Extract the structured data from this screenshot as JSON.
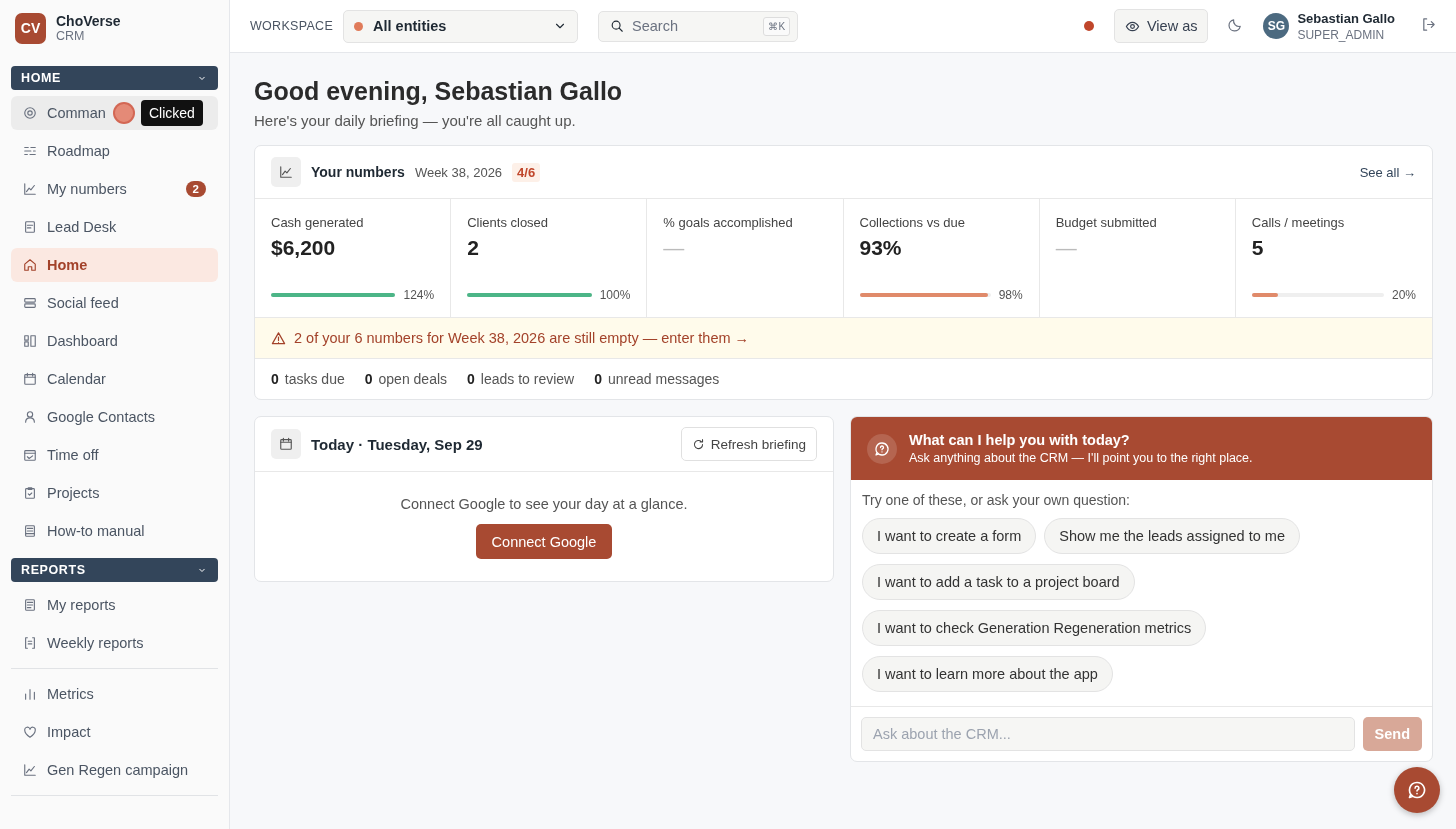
{
  "brand": {
    "initials": "CV",
    "name": "ChoVerse",
    "subtitle": "CRM"
  },
  "sidebar": {
    "groups": [
      {
        "title": "HOME",
        "expanded": true,
        "items": [
          {
            "label": "Comman",
            "selected": false,
            "hovered": true
          },
          {
            "label": "Roadmap",
            "selected": false,
            "hovered": false
          },
          {
            "label": "My numbers",
            "selected": false,
            "hovered": false,
            "badge": "2"
          },
          {
            "label": "Lead Desk",
            "selected": false,
            "hovered": false
          },
          {
            "label": "Home",
            "selected": true,
            "hovered": false
          },
          {
            "label": "Social feed",
            "selected": false,
            "hovered": false
          },
          {
            "label": "Dashboard",
            "selected": false,
            "hovered": false
          },
          {
            "label": "Calendar",
            "selected": false,
            "hovered": false
          },
          {
            "label": "Google Contacts",
            "selected": false,
            "hovered": false
          },
          {
            "label": "Time off",
            "selected": false,
            "hovered": false
          },
          {
            "label": "Projects",
            "selected": false,
            "hovered": false
          },
          {
            "label": "How-to manual",
            "selected": false,
            "hovered": false
          }
        ]
      },
      {
        "title": "REPORTS",
        "expanded": true,
        "items": [
          {
            "label": "My reports",
            "selected": false,
            "hovered": false
          },
          {
            "label": "Weekly reports",
            "selected": false,
            "hovered": false
          }
        ]
      },
      {
        "items": [
          {
            "label": "Metrics",
            "selected": false,
            "hovered": false
          },
          {
            "label": "Impact",
            "selected": false,
            "hovered": false
          },
          {
            "label": "Gen Regen campaign",
            "selected": false,
            "hovered": false
          }
        ]
      }
    ]
  },
  "click_indicator": {
    "tooltip": "Clicked"
  },
  "topbar": {
    "workspace_label": "WORKSPACE",
    "workspace": {
      "value": "All entities",
      "color": "#e07b5a"
    },
    "search": {
      "placeholder": "Search",
      "shortcut": "⌘K"
    },
    "view_as": "View as",
    "user": {
      "initials": "SG",
      "name": "Sebastian Gallo",
      "role": "SUPER_ADMIN"
    }
  },
  "greeting": {
    "title": "Good evening, Sebastian Gallo",
    "subtitle": "Here's your daily briefing — you're all caught up."
  },
  "numbers": {
    "title": "Your numbers",
    "week": "Week 38, 2026",
    "badge": "4/6",
    "link": "See all →",
    "metrics": [
      {
        "label": "Cash generated",
        "value": "$6,200",
        "level": 1,
        "reading": "124%",
        "color": "#4cb587"
      },
      {
        "label": "Clients closed",
        "value": "2",
        "level": 1,
        "reading": "100%",
        "color": "#4cb587"
      },
      {
        "label": "% goals accomplished",
        "value": "—"
      },
      {
        "label": "Collections vs due",
        "value": "93%",
        "level": 0.98,
        "reading": "98%",
        "color": "#e08a6a"
      },
      {
        "label": "Budget submitted",
        "value": "—"
      },
      {
        "label": "Calls / meetings",
        "value": "5",
        "level": 0.2,
        "reading": "20%",
        "color": "#e08a6a"
      }
    ],
    "alert": "2 of your 6 numbers for Week 38, 2026 are still empty — enter them →",
    "counts": [
      {
        "count": "0",
        "label": "tasks due"
      },
      {
        "count": "0",
        "label": "open deals"
      },
      {
        "count": "0",
        "label": "leads to review"
      },
      {
        "count": "0",
        "label": "unread messages"
      }
    ]
  },
  "today": {
    "title": "Today · Tuesday, Sep 29",
    "refresh": "Refresh briefing",
    "message": "Connect Google to see your day at a glance.",
    "button": "Connect Google"
  },
  "assistant": {
    "title": "What can I help you with today?",
    "subtitle": "Ask anything about the CRM — I'll point you to the right place.",
    "prompt": "Try one of these, or ask your own question:",
    "suggestions": [
      "I want to create a form",
      "Show me the leads assigned to me",
      "I want to add a task to a project board",
      "I want to check Generation Regeneration metrics",
      "I want to learn more about the app"
    ],
    "placeholder": "Ask about the CRM...",
    "send": {
      "label": "Send",
      "disabled": true
    }
  }
}
